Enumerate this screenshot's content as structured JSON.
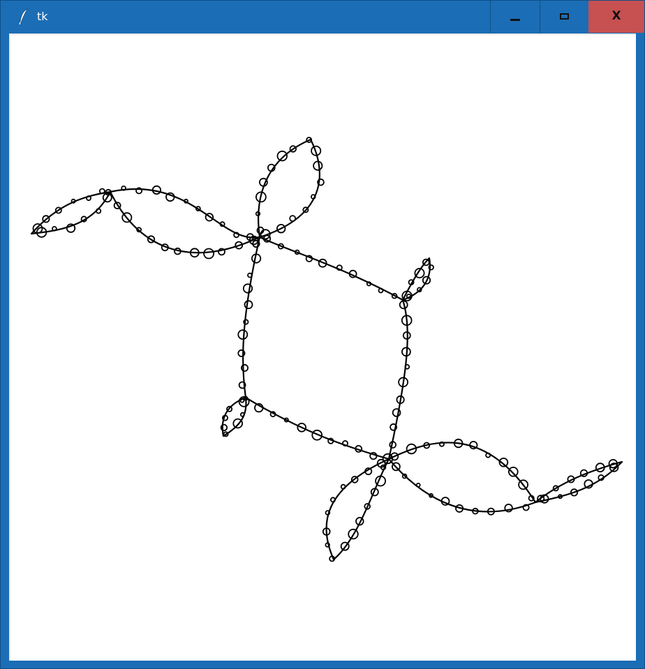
{
  "window": {
    "title": "tk",
    "app_icon": "feather-icon",
    "controls": {
      "minimize": "minimize-icon",
      "maximize": "maximize-icon",
      "close_label": "X"
    },
    "colors": {
      "titlebar": "#1b6db5",
      "close_button": "#c75050",
      "canvas": "#ffffff",
      "fractal_stroke": "#000000"
    }
  },
  "canvas": {
    "content": "julia-set-fractal"
  }
}
